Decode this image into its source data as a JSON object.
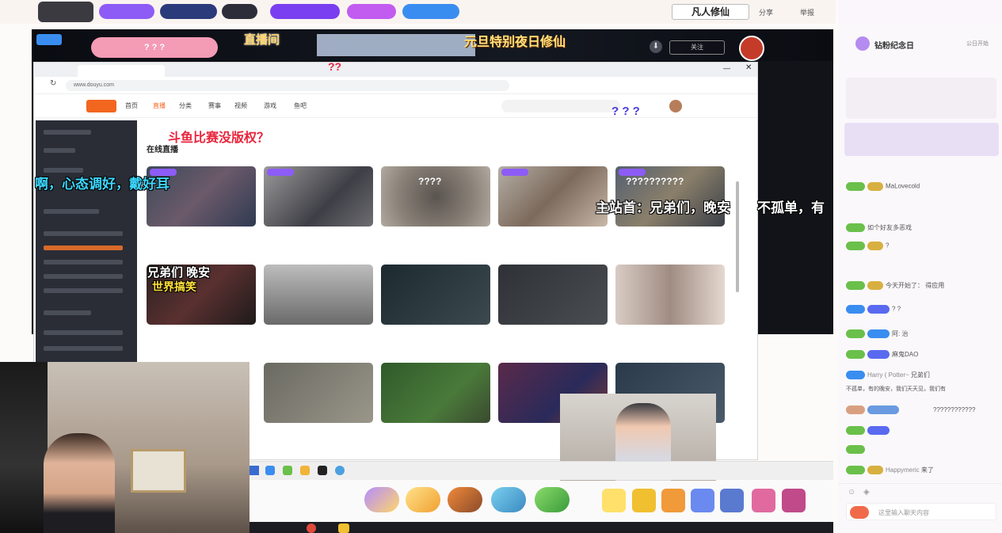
{
  "top_tags": [
    "",
    ""
  ],
  "brand_logo_text": "凡人修仙",
  "share_label": "分享",
  "report_label": "举报",
  "stream_banner": {
    "left_text": "直播间",
    "question_marks": "? ? ?",
    "center_text": "元旦特别夜日修仙",
    "follow_label": "关注"
  },
  "overlay_red_title": "斗鱼比赛没版权？",
  "overlay_question_1": "??",
  "overlay_question_2": "? ? ?",
  "danmu": {
    "left": "啊，心态调好，戴好耳",
    "right": "主站首：兄弟们，晚安",
    "far_right": "不孤单，有",
    "card_overlay": "兄弟们 晚安",
    "card_overlay2": "世界搞笑",
    "question_cluster": "??????????",
    "question_cluster2": "????"
  },
  "browser": {
    "address": "www.douyu.com",
    "nav": [
      "首页",
      "直播",
      "分类",
      "赛事",
      "视频",
      "游戏",
      "鱼吧"
    ],
    "section_title": "在线直播",
    "cards_row1": [
      "",
      "",
      "",
      "",
      ""
    ],
    "cards_row2": [
      "",
      "",
      "",
      "",
      ""
    ],
    "cards_row3": [
      "",
      "",
      "",
      "",
      ""
    ]
  },
  "chat": {
    "header": "钻粉纪念日",
    "header_sub": "公日开始",
    "messages": [
      {
        "user": "MaLovecold",
        "text": ""
      },
      {
        "user": "",
        "text": "如个好友多恶戏"
      },
      {
        "user": "",
        "text": "?"
      },
      {
        "user": "",
        "text": "今天开始了： 得应用"
      },
      {
        "user": "",
        "text": "? ?"
      },
      {
        "user": "",
        "text": "阿: 治"
      },
      {
        "user": "",
        "text": "麻鬼DAO"
      },
      {
        "user": "Harry ( Potter~",
        "text": "兄弟们"
      },
      {
        "user": "",
        "text": "不孤单，有的晚安，我们天天见，我们有"
      },
      {
        "user": "",
        "text": "????????????"
      },
      {
        "user": "",
        "text": ""
      },
      {
        "user": "",
        "text": ""
      },
      {
        "user": "Happymeric",
        "text": "来了"
      }
    ],
    "input_placeholder": "这里输入聊天内容"
  },
  "colors": {
    "chip1": "#8d5cf6",
    "chip2": "#3358d6",
    "chip3": "#2d2d3a",
    "chip4": "#7a3ff0",
    "chip5": "#c25cf0",
    "chip6": "#3a8df0"
  }
}
